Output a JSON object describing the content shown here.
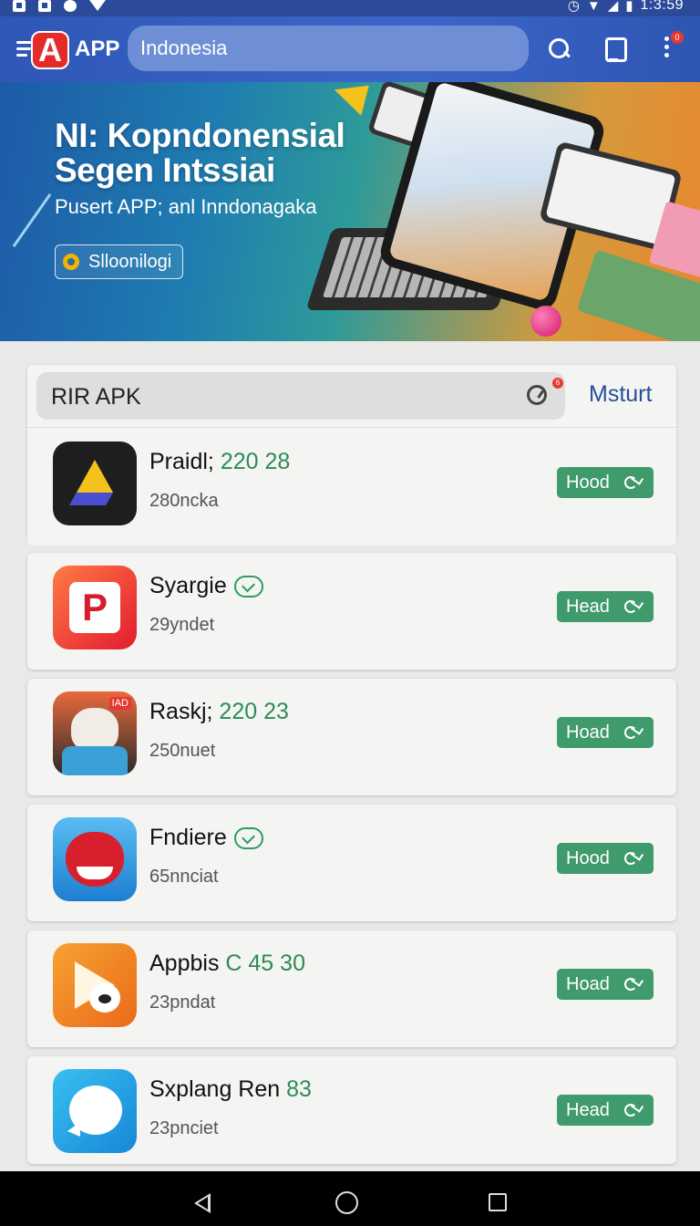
{
  "status_bar": {
    "time": "1:3:59"
  },
  "app_bar": {
    "logo_letter": "A",
    "app_name": "APP",
    "search_value": "Indonesia",
    "notification_count": "0"
  },
  "banner": {
    "title_line1": "NI: Kopndonensial",
    "title_line2": "Segen Intssiai",
    "subtitle": "Pusert APP; anl Inndonagaka",
    "button_label": "Slloonilogi"
  },
  "section": {
    "label": "RIR APK",
    "badge": "6",
    "action_label": "Msturt"
  },
  "apps": [
    {
      "name": "Praidl;",
      "number": "220 28",
      "sub": "280ncka",
      "button": "Hood"
    },
    {
      "name": "Syargie",
      "number": "",
      "sub": "29yndet",
      "button": "Head"
    },
    {
      "name": "Raskj;",
      "number": "220 23",
      "sub": "250nuet",
      "button": "Hoad",
      "icon_tag": "IAD"
    },
    {
      "name": "Fndiere",
      "number": "",
      "sub": "65nnciat",
      "button": "Hood"
    },
    {
      "name": "Appbis",
      "number": "C 45 30",
      "sub": "23pndat",
      "button": "Hoad"
    },
    {
      "name": "Sxplang Ren",
      "number": "83",
      "sub": "23pnciet",
      "button": "Head"
    }
  ],
  "colors": {
    "app_bar": "#3b66c9",
    "accent_green": "#3f9a6c",
    "logo_red": "#e52a2a",
    "link_blue": "#274e9c"
  }
}
